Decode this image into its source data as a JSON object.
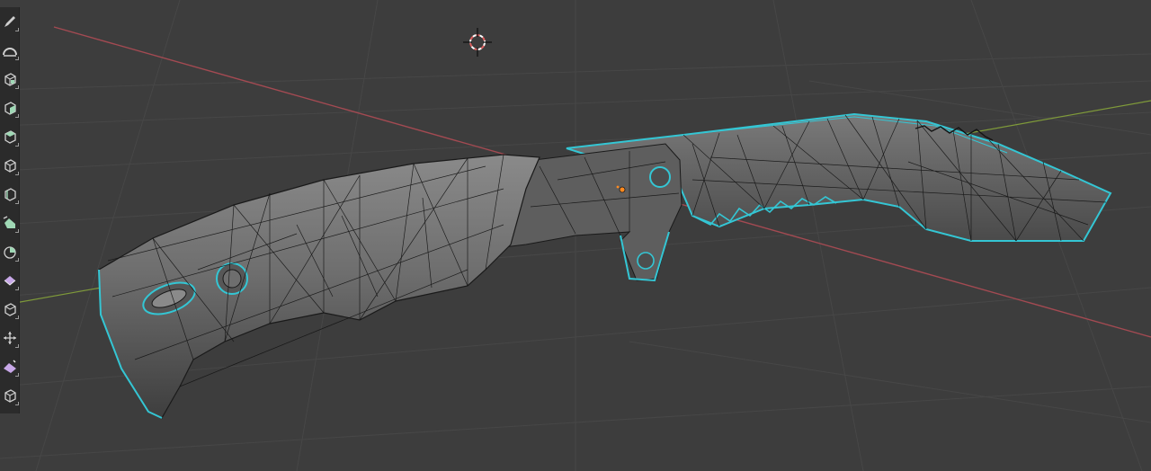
{
  "app": "Blender",
  "viewport": {
    "background": "#3d3d3d",
    "grid_color": "#484848",
    "x_axis_color": "#a34a52",
    "y_axis_color": "#7f9a3a",
    "selection_outline_color": "#34c6d4",
    "mesh_fill": "#6a6a6a",
    "wire_color": "#141414",
    "origin_color": "#ff8a1f",
    "cursor_color": "#e06060"
  },
  "toolbar": {
    "tools": [
      {
        "name": "annotate-tool",
        "icon": "pencil-icon",
        "tint": "#cfcfcf"
      },
      {
        "name": "measure-tool",
        "icon": "arc-measure-icon",
        "tint": "#cfcfcf"
      },
      {
        "name": "add-cube-tool",
        "icon": "cube-plus-icon",
        "tint": "#9fd8b5"
      },
      {
        "name": "extrude-region-tool",
        "icon": "extrude-icon",
        "tint": "#9fd8b5"
      },
      {
        "name": "inset-faces-tool",
        "icon": "inset-icon",
        "tint": "#9fd8b5"
      },
      {
        "name": "bevel-tool",
        "icon": "bevel-icon",
        "tint": "#cfcfcf"
      },
      {
        "name": "loop-cut-tool",
        "icon": "loop-cut-icon",
        "tint": "#cfcfcf"
      },
      {
        "name": "knife-tool",
        "icon": "knife-icon",
        "tint": "#9fd8b5"
      },
      {
        "name": "poly-build-tool",
        "icon": "poly-build-icon",
        "tint": "#9fd8b5"
      },
      {
        "name": "spin-tool",
        "icon": "spin-icon",
        "tint": "#c8a8e8"
      },
      {
        "name": "smooth-tool",
        "icon": "smooth-icon",
        "tint": "#cfcfcf"
      },
      {
        "name": "edge-slide-tool",
        "icon": "edge-slide-icon",
        "tint": "#cfcfcf"
      },
      {
        "name": "shrink-fatten-tool",
        "icon": "shrink-fatten-icon",
        "tint": "#c8a8e8"
      },
      {
        "name": "shear-tool",
        "icon": "shear-icon",
        "tint": "#cfcfcf"
      }
    ]
  }
}
